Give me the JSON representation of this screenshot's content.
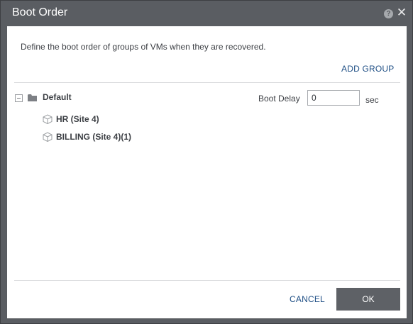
{
  "dialog": {
    "title": "Boot Order",
    "help_icon": "question-circle-icon",
    "close_icon": "close-icon",
    "help_glyph": "?",
    "close_glyph": "✕"
  },
  "content": {
    "description": "Define the boot order of groups of VMs when they are recovered.",
    "add_group_label": "ADD GROUP"
  },
  "group": {
    "name": "Default",
    "expanded": true,
    "boot_delay_label": "Boot Delay",
    "boot_delay_value": "0",
    "boot_delay_unit": "sec",
    "vms": [
      {
        "label": "HR (Site 4)"
      },
      {
        "label": "BILLING (Site 4)(1)"
      }
    ]
  },
  "footer": {
    "cancel_label": "CANCEL",
    "ok_label": "OK"
  },
  "colors": {
    "titlebar": "#5a5d62",
    "link": "#1f4f85",
    "primary_button": "#5e6166",
    "text": "#3c3f44"
  }
}
